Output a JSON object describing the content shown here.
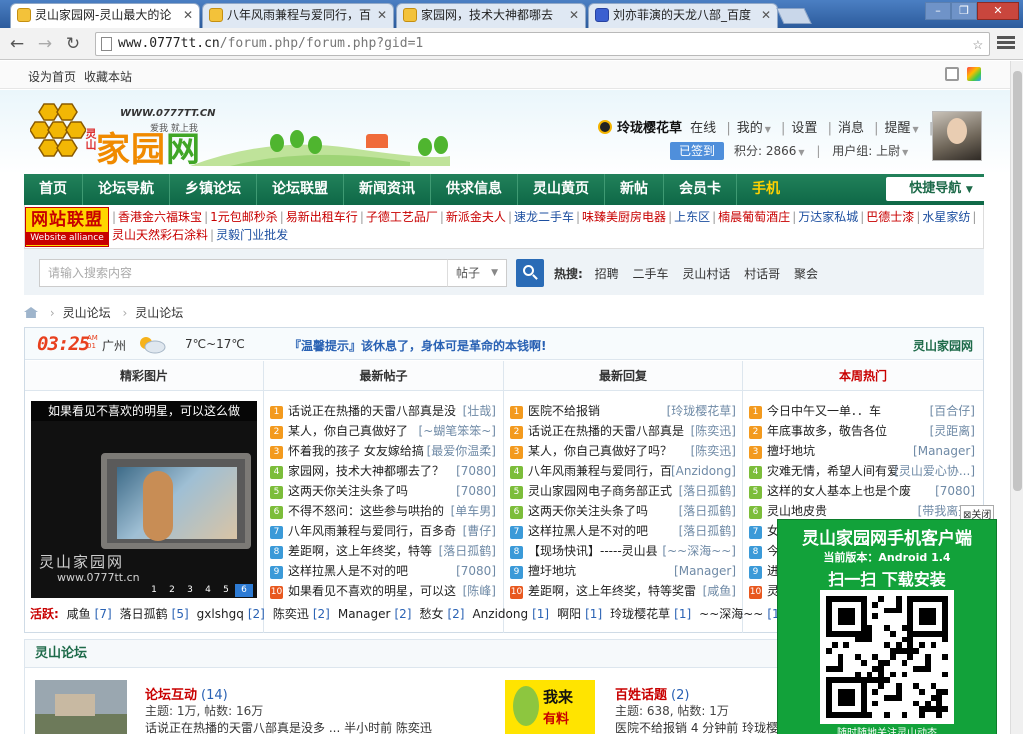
{
  "browser": {
    "tabs": [
      {
        "title": "灵山家园网-灵山最大的论",
        "active": true
      },
      {
        "title": "八年风雨兼程与爱同行，百",
        "active": false
      },
      {
        "title": "家园网，技术大神都哪去",
        "active": false
      },
      {
        "title": "刘亦菲演的天龙八部_百度",
        "active": false
      }
    ],
    "url_host": "www.0777tt.cn",
    "url_path": "/forum.php/forum.php?gid=1"
  },
  "topbar": {
    "set_home": "设为首页",
    "bookmark": "收藏本站"
  },
  "logo": {
    "name_a": "家园",
    "name_b": "网",
    "side": "灵山",
    "url": "WWW.0777TT.CN",
    "slogan": "爱我 就上我"
  },
  "user": {
    "name": "玲珑樱花草",
    "status": "在线",
    "mine": "我的",
    "settings": "设置",
    "messages": "消息",
    "remind": "提醒",
    "logout": "退出",
    "signed": "已签到",
    "credit": "积分: 2866",
    "group": "用户组: 上尉"
  },
  "nav": {
    "items": [
      "首页",
      "论坛导航",
      "乡镇论坛",
      "论坛联盟",
      "新闻资讯",
      "供求信息",
      "灵山黄页",
      "新帖",
      "会员卡"
    ],
    "mobile": "手机",
    "quick": "快捷导航"
  },
  "alliance": {
    "badge_top": "网站联盟",
    "badge_bottom": "Website alliance",
    "links": [
      {
        "text": "香港金六福珠宝",
        "blue": false
      },
      {
        "text": "1元包邮秒杀",
        "blue": false
      },
      {
        "text": "易新出租车行",
        "blue": false
      },
      {
        "text": "子德工艺品厂",
        "blue": false
      },
      {
        "text": "新派金夫人",
        "blue": false
      },
      {
        "text": "速龙二手车",
        "blue": true
      },
      {
        "text": "味臻美厨房电器",
        "blue": false
      },
      {
        "text": "上东区",
        "blue": true
      },
      {
        "text": "楠晨葡萄酒庄",
        "blue": false
      },
      {
        "text": "万达家私城",
        "blue": true
      },
      {
        "text": "巴德士漆",
        "blue": false
      },
      {
        "text": "水星家纺",
        "blue": true
      },
      {
        "text": "灵山天然彩石涂料",
        "blue": false
      },
      {
        "text": "灵毅门业批发",
        "blue": true
      }
    ]
  },
  "search": {
    "placeholder": "请输入搜索内容",
    "type": "帖子",
    "hot_label": "热搜:",
    "hot": [
      "招聘",
      "二手车",
      "灵山村话",
      "村话哥",
      "聚会"
    ]
  },
  "breadcrumb": [
    "灵山论坛",
    "灵山论坛"
  ],
  "infobar": {
    "time": "03:25",
    "ampm_top": "AM",
    "ampm_bot": "01",
    "city": "广州",
    "temp": "7℃~17℃",
    "tip": "『温馨提示』该休息了，身体可是革命的本钱啊!",
    "brand": "灵山家园网"
  },
  "columns": {
    "pics": "精彩图片",
    "new_posts": "最新帖子",
    "new_replies": "最新回复",
    "hot": "本周热门"
  },
  "picture": {
    "caption": "如果看见不喜欢的明星，可以这么做",
    "watermark": "灵山家园网",
    "watermark_url": "www.0777tt.cn",
    "pages": [
      "1",
      "2",
      "3",
      "4",
      "5",
      "6"
    ]
  },
  "new_posts": [
    {
      "t": "话说正在热播的天雷八部真是没",
      "u": "[壮哉]"
    },
    {
      "t": "某人，你自己真做好了",
      "u": "[~蝴笔笨笨~]"
    },
    {
      "t": "怀着我的孩子 女友嫁给搞",
      "u": "[最爱你温柔]"
    },
    {
      "t": "家园网，技术大神都哪去了？",
      "u": "[7080]"
    },
    {
      "t": "这两天你关注头条了吗",
      "u": "[7080]"
    },
    {
      "t": "不得不怒问：这些参与哄抬的",
      "u": "[单车男]"
    },
    {
      "t": "八年风雨兼程与爱同行，百多奇",
      "u": "[曹仔]"
    },
    {
      "t": "差距啊，这上年终奖，特等",
      "u": "[落日孤鹤]"
    },
    {
      "t": "这样拉黑人是不对的吧",
      "u": "[7080]"
    },
    {
      "t": "如果看见不喜欢的明星，可以这",
      "u": "[陈峰]"
    }
  ],
  "new_replies": [
    {
      "t": "医院不给报销",
      "u": "[玲珑樱花草]"
    },
    {
      "t": "话说正在热播的天雷八部真是",
      "u": "[陈奕迅]"
    },
    {
      "t": "某人，你自己真做好了吗？",
      "u": "[陈奕迅]"
    },
    {
      "t": "八年风雨兼程与爱同行，百",
      "u": "[Anzidong]"
    },
    {
      "t": "灵山家园网电子商务部正式",
      "u": "[落日孤鹤]"
    },
    {
      "t": "这两天你关注头条了吗",
      "u": "[落日孤鹤]"
    },
    {
      "t": "这样拉黑人是不对的吧",
      "u": "[落日孤鹤]"
    },
    {
      "t": "【现场快讯】-----灵山县",
      "u": "[~~深海~~]"
    },
    {
      "t": "擅圩地坑",
      "u": "[Manager]"
    },
    {
      "t": "差距啊，这上年终奖，特等奖雷",
      "u": "[咸鱼]"
    }
  ],
  "hot_week": [
    {
      "t": "今日中午又一单．．车",
      "u": "[百合仔]"
    },
    {
      "t": "年底事故多，敬告各位",
      "u": "[灵距离]"
    },
    {
      "t": "擅圩地坑",
      "u": "[Manager]"
    },
    {
      "t": "灾难无情，希望人间有爱",
      "u": "[灵山爱心协...]"
    },
    {
      "t": "这样的女人基本上也是个废",
      "u": "[7080]"
    },
    {
      "t": "灵山地皮贵",
      "u": "[带我离开]"
    },
    {
      "t": "女",
      "u": ""
    },
    {
      "t": "今",
      "u": ""
    },
    {
      "t": "进",
      "u": ""
    },
    {
      "t": "灵",
      "u": ""
    }
  ],
  "active_users": {
    "label": "活跃:",
    "users": [
      {
        "n": "咸鱼",
        "c": "[7]"
      },
      {
        "n": "落日孤鹤",
        "c": "[5]"
      },
      {
        "n": "gxlshgq",
        "c": "[2]"
      },
      {
        "n": "陈奕迅",
        "c": "[2]"
      },
      {
        "n": "Manager",
        "c": "[2]"
      },
      {
        "n": "愁女",
        "c": "[2]"
      },
      {
        "n": "Anzidong",
        "c": "[1]"
      },
      {
        "n": "啊阳",
        "c": "[1]"
      },
      {
        "n": "玲珑樱花草",
        "c": "[1]"
      },
      {
        "n": "~~深海~~",
        "c": "[1]"
      }
    ]
  },
  "forum_section": {
    "title": "灵山论坛",
    "forums": [
      {
        "name": "论坛互动",
        "count": "(14)",
        "meta": "主题: 1万, 帖数: 16万",
        "last": "话说正在热播的天雷八部真是没多 ... 半小时前 陈奕迅"
      },
      {
        "name": "百姓话题",
        "count": "(2)",
        "meta": "主题: 638, 帖数: 1万",
        "last": "医院不给报销 4 分钟前 玲珑樱花草"
      }
    ],
    "badge_a": "我来",
    "badge_b": "有料"
  },
  "app_ad": {
    "close": "关闭",
    "title": "灵山家园网手机客户端",
    "version": "当前版本：Android 1.4",
    "scan": "扫一扫 下载安装",
    "foot": "随时随地关注灵山动态"
  },
  "colors": {
    "nav_green": "#0e6847",
    "accent_orange": "#f08a00",
    "link_blue": "#2a62b4",
    "alert_red": "#c80000",
    "app_green": "#12a23a"
  }
}
